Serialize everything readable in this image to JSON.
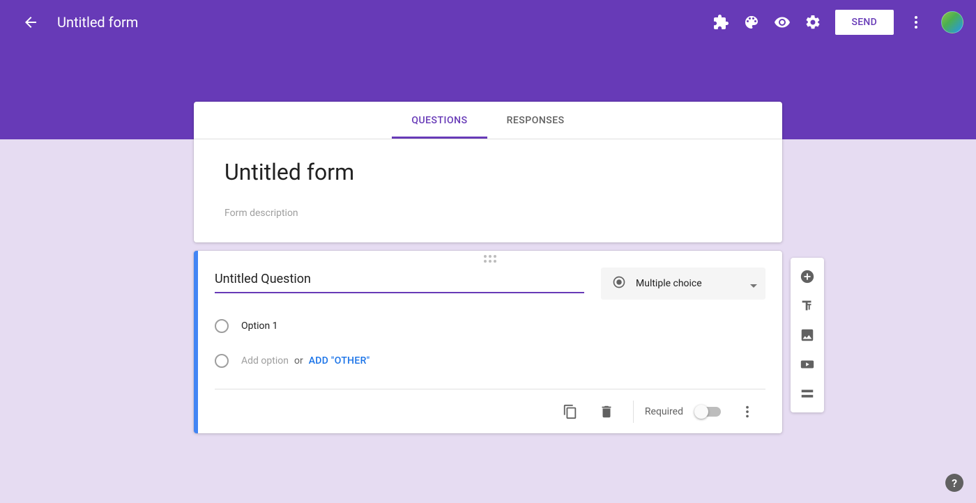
{
  "header": {
    "doc_title": "Untitled form",
    "send_label": "SEND"
  },
  "tabs": {
    "questions": "QUESTIONS",
    "responses": "RESPONSES"
  },
  "form": {
    "title": "Untitled form",
    "description_placeholder": "Form description"
  },
  "question": {
    "title": "Untitled Question",
    "type_label": "Multiple choice",
    "option1": "Option 1",
    "add_option_placeholder": "Add option",
    "or_text": "or",
    "add_other": "ADD \"OTHER\"",
    "required_label": "Required"
  },
  "colors": {
    "primary": "#673ab7",
    "accent_border": "#4285f4",
    "link": "#1a73e8"
  }
}
